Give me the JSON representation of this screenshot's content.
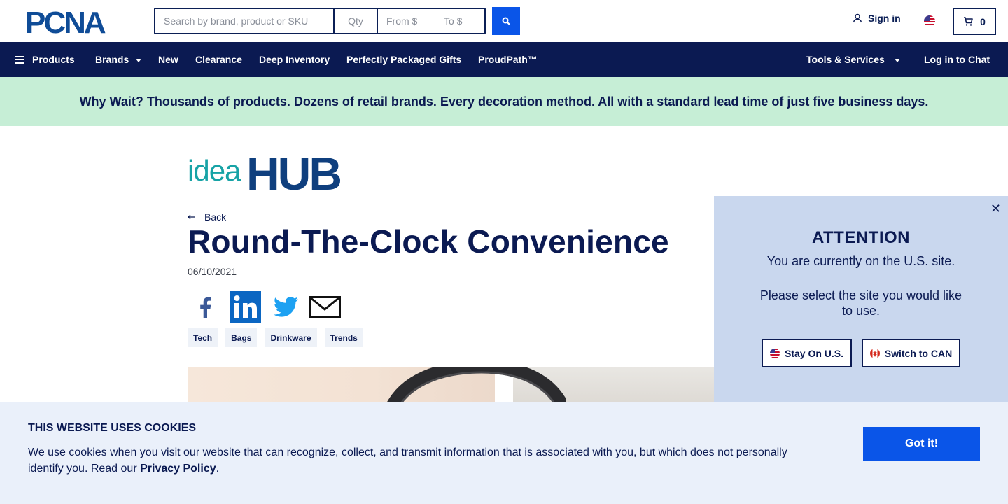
{
  "header": {
    "logo_text": "PCNA",
    "search": {
      "placeholder": "Search by brand, product or SKU",
      "qty_placeholder": "Qty",
      "from_placeholder": "From $",
      "range_dash": "—",
      "to_placeholder": "To $",
      "button_icon": "search-icon"
    },
    "sign_in_label": "Sign in",
    "region_flag": "us-flag-icon",
    "cart_count": "0"
  },
  "nav": {
    "items": [
      {
        "label": "Products",
        "icon": "menu-icon"
      },
      {
        "label": "Brands",
        "dropdown": true
      },
      {
        "label": "New"
      },
      {
        "label": "Clearance"
      },
      {
        "label": "Deep Inventory"
      },
      {
        "label": "Perfectly Packaged Gifts"
      },
      {
        "label": "ProudPath™"
      }
    ],
    "right_items": [
      {
        "label": "Tools & Services",
        "dropdown": true
      },
      {
        "label": "Log in to Chat"
      }
    ]
  },
  "promo_banner": "Why Wait? Thousands of products. Dozens of retail brands. Every decoration method. All with a standard lead time of just five business days.",
  "article": {
    "brand_logo_text": {
      "light": "idea",
      "bold": "HUB"
    },
    "back_label": "Back",
    "title": "Round-The-Clock Convenience",
    "date": "06/10/2021",
    "share_icons": [
      "facebook-icon",
      "linkedin-icon",
      "twitter-icon",
      "email-icon"
    ],
    "tags": [
      "Tech",
      "Bags",
      "Drinkware",
      "Trends"
    ]
  },
  "region_modal": {
    "title": "ATTENTION",
    "line1": "You are currently on the U.S. site.",
    "line2": "Please select the site you would like to use.",
    "stay_label": "Stay On U.S.",
    "switch_label": "Switch to CAN",
    "close_glyph": "✕"
  },
  "cookie_banner": {
    "title": "THIS WEBSITE USES COOKIES",
    "text": "We use cookies when you visit our website that can recognize, collect, and transmit information that is associated with you, but which does not personally identify you. Read our ",
    "link_label": "Privacy Policy",
    "text_end": ".",
    "button_label": "Got it!"
  },
  "colors": {
    "navy": "#0b1a52",
    "accent_blue": "#0a55e8",
    "promo_green": "#c6eed6",
    "modal_bg": "#c9d7ee",
    "cookie_bg": "#eaf0fa",
    "ideahub_teal": "#17a3a6",
    "ideahub_navy": "#0f3f7e"
  }
}
